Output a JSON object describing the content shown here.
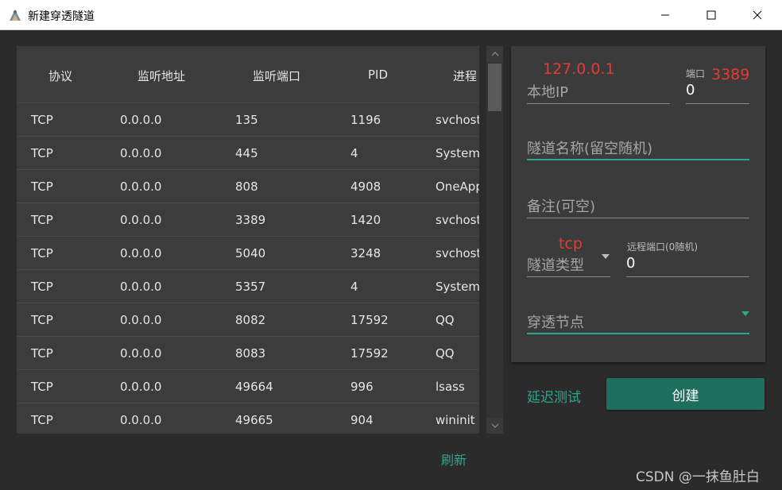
{
  "window": {
    "title": "新建穿透隧道",
    "icon": "app-icon",
    "controls": [
      "minimize-icon",
      "maximize-icon",
      "close-icon"
    ]
  },
  "table": {
    "columns": [
      "协议",
      "监听地址",
      "监听端口",
      "PID",
      "进程"
    ],
    "rows": [
      [
        "TCP",
        "0.0.0.0",
        "135",
        "1196",
        "svchost"
      ],
      [
        "TCP",
        "0.0.0.0",
        "445",
        "4",
        "System"
      ],
      [
        "TCP",
        "0.0.0.0",
        "808",
        "4908",
        "OneApp"
      ],
      [
        "TCP",
        "0.0.0.0",
        "3389",
        "1420",
        "svchost"
      ],
      [
        "TCP",
        "0.0.0.0",
        "5040",
        "3248",
        "svchost"
      ],
      [
        "TCP",
        "0.0.0.0",
        "5357",
        "4",
        "System"
      ],
      [
        "TCP",
        "0.0.0.0",
        "8082",
        "17592",
        "QQ"
      ],
      [
        "TCP",
        "0.0.0.0",
        "8083",
        "17592",
        "QQ"
      ],
      [
        "TCP",
        "0.0.0.0",
        "49664",
        "996",
        "lsass"
      ],
      [
        "TCP",
        "0.0.0.0",
        "49665",
        "904",
        "wininit"
      ]
    ]
  },
  "refresh_label": "刷新",
  "form": {
    "local_ip_annotation": "127.0.0.1",
    "local_ip_label": "本地IP",
    "port_label": "端口",
    "port_annotation": "3389",
    "port_value": "0",
    "tunnel_name_placeholder": "隧道名称(留空随机)",
    "remark_placeholder": "备注(可空)",
    "tunnel_type_annotation": "tcp",
    "tunnel_type_label": "隧道类型",
    "remote_port_label": "远程端口(0随机)",
    "remote_port_value": "0",
    "node_label": "穿透节点"
  },
  "delay_test_label": "延迟测试",
  "create_label": "创建",
  "watermark": "CSDN @一抹鱼肚白",
  "colors": {
    "accent": "#2fa58f",
    "button": "#1e6e5e",
    "annotation": "#e53935",
    "panel": "#3c3c3c",
    "background": "#2b2b2b"
  }
}
